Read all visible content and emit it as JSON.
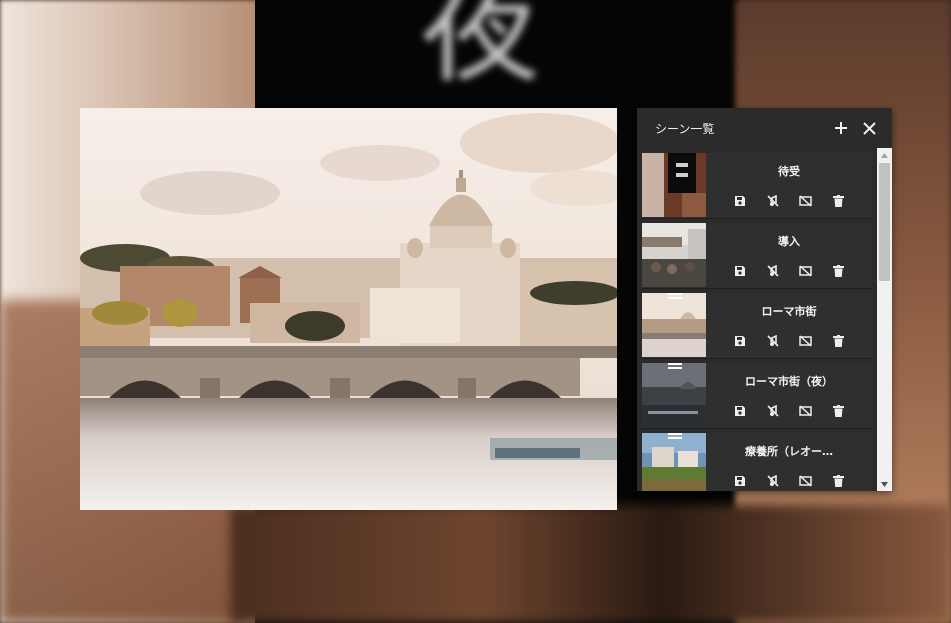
{
  "background": {
    "glyph_top": "夜"
  },
  "panel": {
    "title": "シーン一覧",
    "add_icon": "plus-icon",
    "close_icon": "close-icon"
  },
  "scenes": [
    {
      "name": "待受",
      "thumb": "dark-street"
    },
    {
      "name": "導入",
      "thumb": "cafe-street"
    },
    {
      "name": "ローマ市街",
      "thumb": "rome-day"
    },
    {
      "name": "ローマ市街（夜）",
      "thumb": "rome-night"
    },
    {
      "name": "療養所（レオー…",
      "thumb": "sanatorium"
    }
  ],
  "actions": {
    "save_icon": "save-icon",
    "mute_icon": "mute-icon",
    "hide_icon": "hide-icon",
    "delete_icon": "delete-icon"
  },
  "colors": {
    "panel_bg": "#2b2b2b",
    "item_bg": "#2f2f2f",
    "text": "#f2f2f2"
  }
}
